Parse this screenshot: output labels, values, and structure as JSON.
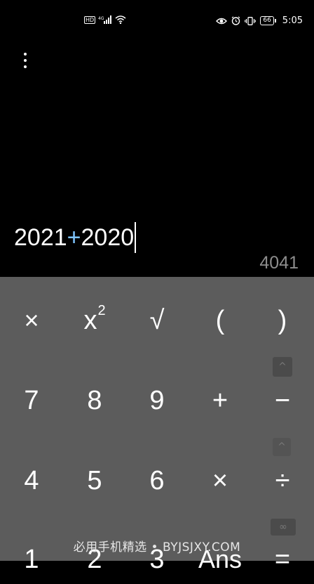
{
  "status_bar": {
    "left_icons": [
      "hd-icon",
      "signal-icon",
      "wifi-icon"
    ],
    "hd_label": "HD",
    "right_icons": [
      "eye-icon",
      "alarm-icon",
      "vibrate-icon",
      "battery-icon"
    ],
    "battery": "66",
    "time": "5:05"
  },
  "display": {
    "expression_left": "2021",
    "expression_operator": "+",
    "expression_right": "2020",
    "result": "4041"
  },
  "keys": {
    "mul_top": "×",
    "square_base": "x",
    "square_exp": "2",
    "sqrt": "√",
    "open_paren": "(",
    "close_paren": ")",
    "seven": "7",
    "eight": "8",
    "nine": "9",
    "plus": "+",
    "minus": "−",
    "four": "4",
    "five": "5",
    "six": "6",
    "multiply": "×",
    "divide": "÷",
    "one": "1",
    "two": "2",
    "three": "3",
    "ans": "Ans",
    "equals": "="
  },
  "side_buttons": {
    "caret_up": "^",
    "caret_small": "^",
    "infinity": "∞"
  },
  "watermark": "必用手机精选 • BYJSJXY.COM",
  "colors": {
    "background": "#000000",
    "keypad": "#5c5c5c",
    "operator_accent": "#7ec4ff",
    "result_text": "#8d8d8d"
  }
}
